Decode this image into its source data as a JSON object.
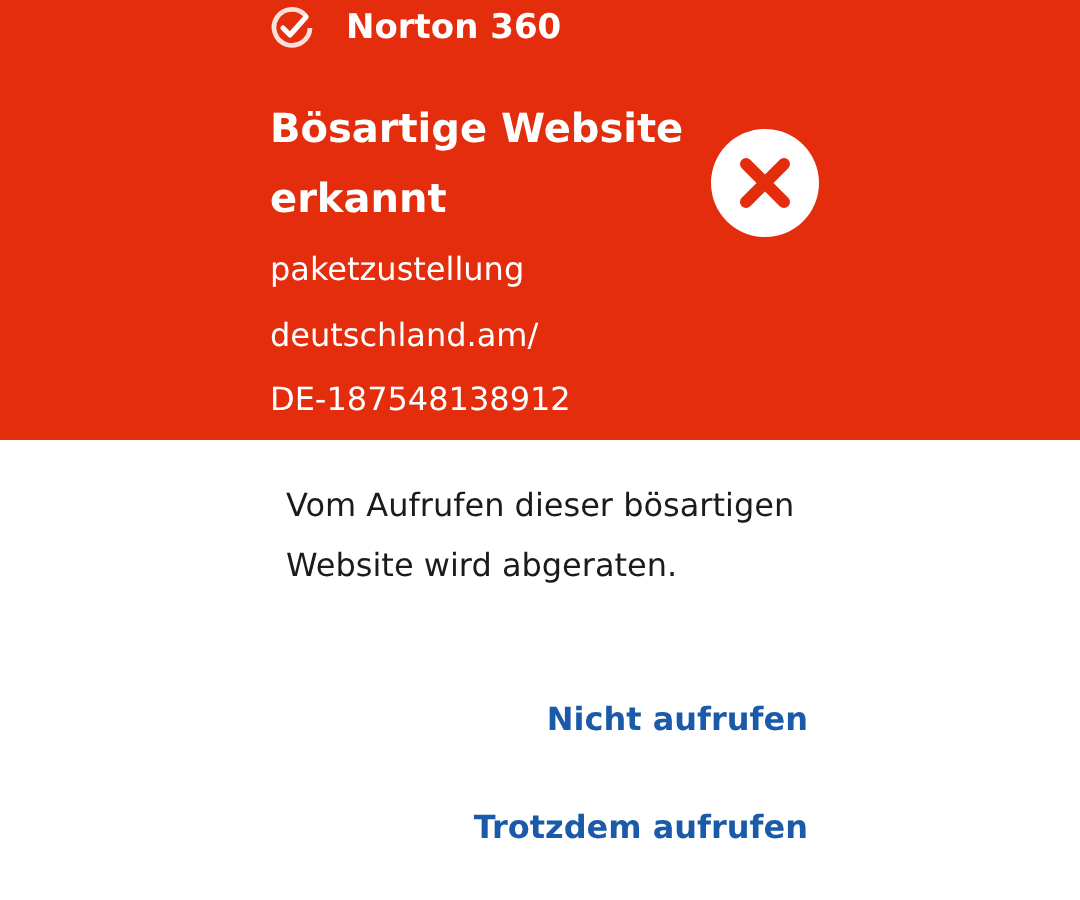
{
  "app": {
    "name": "Norton 360"
  },
  "alert": {
    "title": "Bösartige Website erkannt",
    "url_lines": [
      "paketzustellung",
      "deutschland.am/",
      "DE-187548138912"
    ]
  },
  "message": "Vom Aufrufen dieser bösartigen Website wird abgeraten.",
  "actions": [
    {
      "label": "Nicht aufrufen"
    },
    {
      "label": "Trotzdem aufrufen"
    }
  ]
}
